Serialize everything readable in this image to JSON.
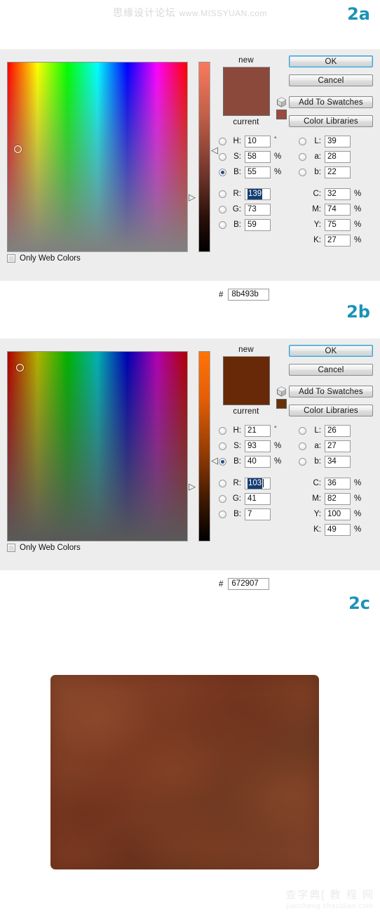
{
  "watermarks": {
    "top_cn": "思缘设计论坛",
    "top_url": "www.MISSYUAN.com",
    "bottom_cn": "查字典[ 教 程 网",
    "bottom_url": "jiaocheng.chazidian.com"
  },
  "step_tags": {
    "a": "2a",
    "b": "2b",
    "c": "2c"
  },
  "picker_a": {
    "labels": {
      "new": "new",
      "current": "current",
      "hash": "#",
      "only_web_colors": "Only Web Colors"
    },
    "buttons": {
      "ok": "OK",
      "cancel": "Cancel",
      "add_to_swatches": "Add To Swatches",
      "color_libraries": "Color Libraries"
    },
    "swatch_new": "#8b493b",
    "swatch_current": "#9b4b3e",
    "selected_mode": "B",
    "hsb": [
      {
        "key": "H",
        "label": "H:",
        "value": "10",
        "unit": "°",
        "selected": false
      },
      {
        "key": "S",
        "label": "S:",
        "value": "58",
        "unit": "%",
        "selected": false
      },
      {
        "key": "B",
        "label": "B:",
        "value": "55",
        "unit": "%",
        "selected": true
      }
    ],
    "rgb": [
      {
        "key": "R",
        "label": "R:",
        "value": "139",
        "unit": "",
        "selected": false,
        "highlighted": true
      },
      {
        "key": "G",
        "label": "G:",
        "value": "73",
        "unit": "",
        "selected": false,
        "highlighted": false
      },
      {
        "key": "B2",
        "label": "B:",
        "value": "59",
        "unit": "",
        "selected": false,
        "highlighted": false
      }
    ],
    "lab": [
      {
        "key": "L",
        "label": "L:",
        "value": "39",
        "unit": "",
        "selected": false
      },
      {
        "key": "a",
        "label": "a:",
        "value": "28",
        "unit": "",
        "selected": false
      },
      {
        "key": "b",
        "label": "b:",
        "value": "22",
        "unit": "",
        "selected": false
      }
    ],
    "cmyk": [
      {
        "key": "C",
        "label": "C:",
        "value": "32",
        "unit": "%"
      },
      {
        "key": "M",
        "label": "M:",
        "value": "74",
        "unit": "%"
      },
      {
        "key": "Y",
        "label": "Y:",
        "value": "75",
        "unit": "%"
      },
      {
        "key": "K",
        "label": "K:",
        "value": "27",
        "unit": "%"
      }
    ],
    "hex": "8b493b",
    "marker": {
      "left_pct": 3.5,
      "top_pct": 44.0
    },
    "slider_thumb_pct": 47.0
  },
  "picker_b": {
    "labels": {
      "new": "new",
      "current": "current",
      "hash": "#",
      "only_web_colors": "Only Web Colors"
    },
    "buttons": {
      "ok": "OK",
      "cancel": "Cancel",
      "add_to_swatches": "Add To Swatches",
      "color_libraries": "Color Libraries"
    },
    "swatch_new": "#672907",
    "swatch_current": "#6a3108",
    "selected_mode": "B",
    "hsb": [
      {
        "key": "H",
        "label": "H:",
        "value": "21",
        "unit": "°",
        "selected": false
      },
      {
        "key": "S",
        "label": "S:",
        "value": "93",
        "unit": "%",
        "selected": false
      },
      {
        "key": "B",
        "label": "B:",
        "value": "40",
        "unit": "%",
        "selected": true
      }
    ],
    "rgb": [
      {
        "key": "R",
        "label": "R:",
        "value": "103",
        "unit": "",
        "selected": false,
        "highlighted": true
      },
      {
        "key": "G",
        "label": "G:",
        "value": "41",
        "unit": "",
        "selected": false,
        "highlighted": false
      },
      {
        "key": "B2",
        "label": "B:",
        "value": "7",
        "unit": "",
        "selected": false,
        "highlighted": false
      }
    ],
    "lab": [
      {
        "key": "L",
        "label": "L:",
        "value": "26",
        "unit": "",
        "selected": false
      },
      {
        "key": "a",
        "label": "a:",
        "value": "27",
        "unit": "",
        "selected": false
      },
      {
        "key": "b",
        "label": "b:",
        "value": "34",
        "unit": "",
        "selected": false
      }
    ],
    "cmyk": [
      {
        "key": "C",
        "label": "C:",
        "value": "36",
        "unit": "%"
      },
      {
        "key": "M",
        "label": "M:",
        "value": "82",
        "unit": "%"
      },
      {
        "key": "Y",
        "label": "Y:",
        "value": "100",
        "unit": "%"
      },
      {
        "key": "K",
        "label": "K:",
        "value": "49",
        "unit": "%"
      }
    ],
    "hex": "672907",
    "marker": {
      "left_pct": 4.5,
      "top_pct": 6.5
    },
    "slider_thumb_pct": 58.0
  },
  "texture": {
    "base_color": "#7b3a22",
    "name": "leather-texture-preview"
  }
}
